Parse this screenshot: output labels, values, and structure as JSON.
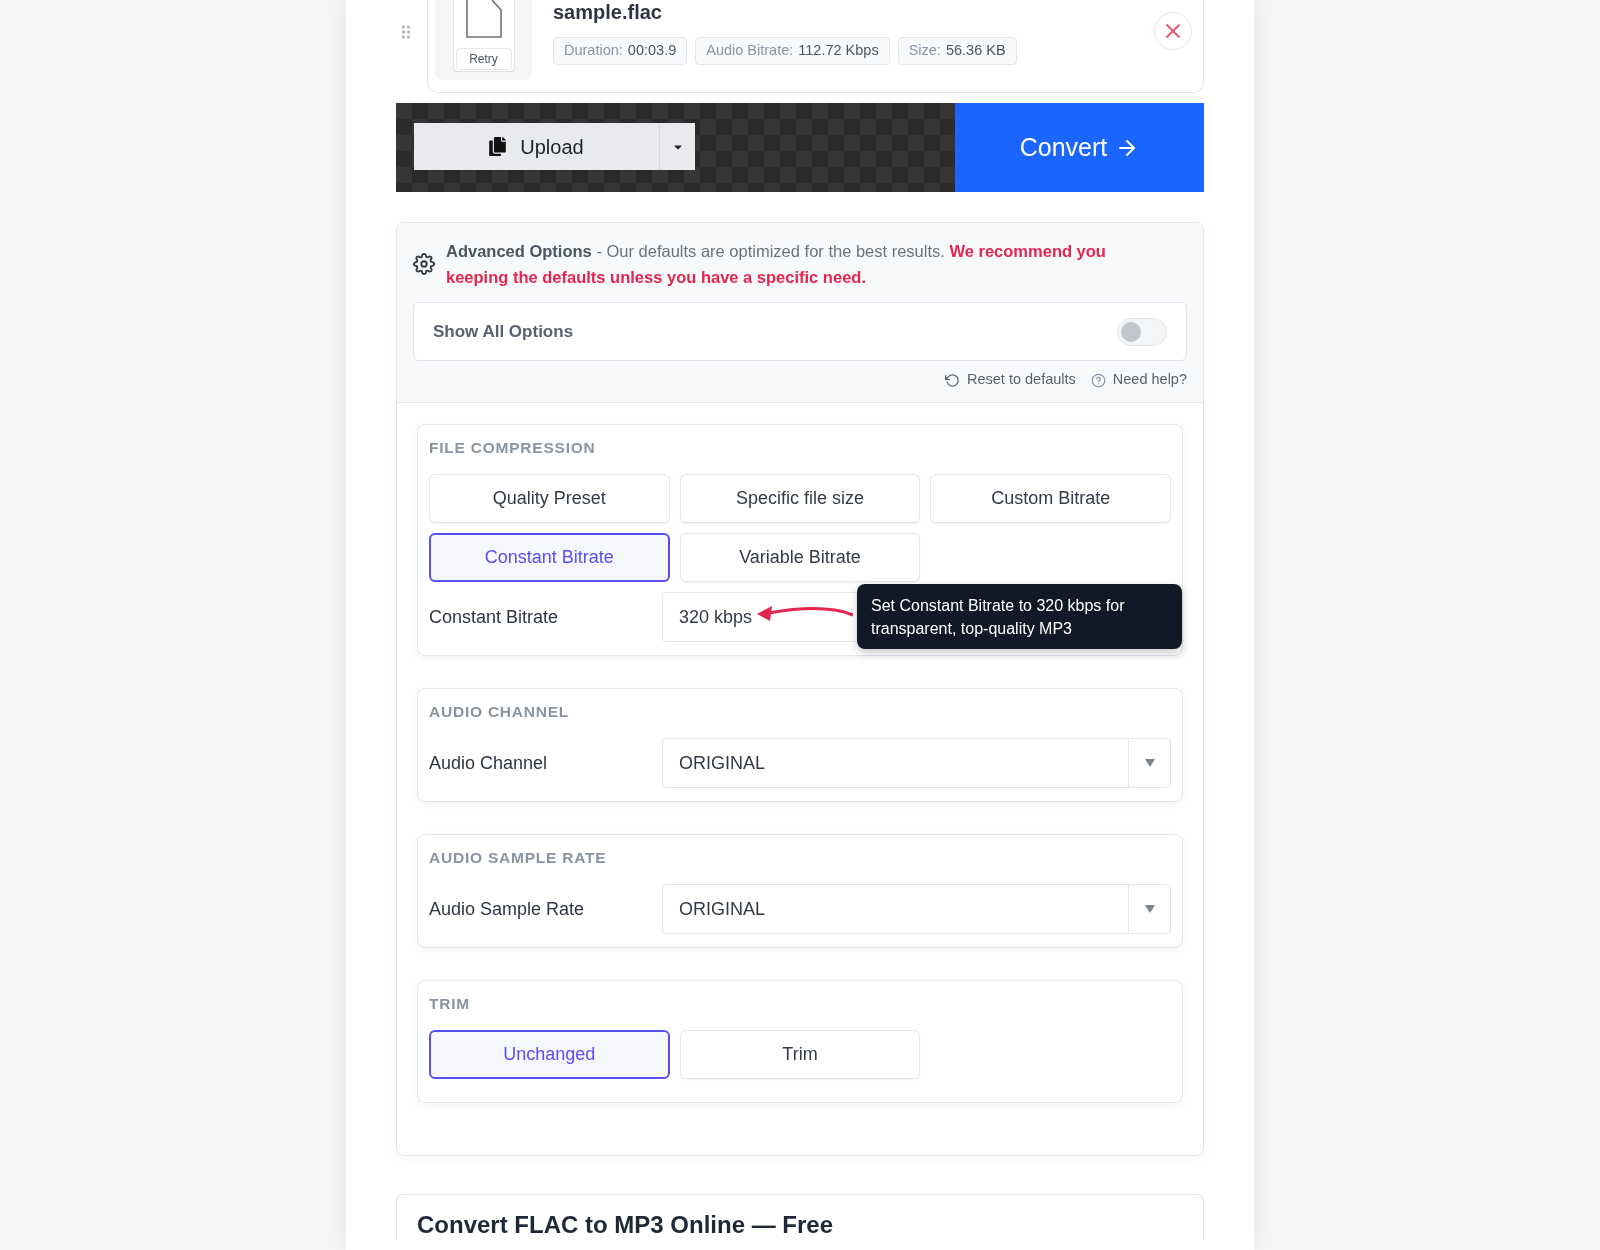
{
  "file": {
    "name": "sample.flac",
    "retry": "Retry",
    "details": [
      {
        "label": "Duration:",
        "value": "00:03.9"
      },
      {
        "label": "Audio Bitrate:",
        "value": "112.72 Kbps"
      },
      {
        "label": "Size:",
        "value": "56.36 KB"
      }
    ]
  },
  "toolbar": {
    "upload": "Upload",
    "convert": "Convert"
  },
  "advanced_options": {
    "title": "Advanced Options",
    "description": "- Our defaults are optimized for the best results.",
    "warning": "We recommend you keeping the defaults unless you have a specific need.",
    "show_all": {
      "label": "Show All Options",
      "on": false
    },
    "links": [
      {
        "kind": "reset",
        "label": "Reset to defaults"
      },
      {
        "kind": "help",
        "label": "Need help?"
      }
    ]
  },
  "sections": [
    {
      "title": "FILE COMPRESSION",
      "options": [
        {
          "label": "Quality Preset",
          "selected": false
        },
        {
          "label": "Specific file size",
          "selected": false
        },
        {
          "label": "Custom Bitrate",
          "selected": false
        },
        {
          "label": "Constant Bitrate",
          "selected": true
        },
        {
          "label": "Variable Bitrate",
          "selected": false
        }
      ],
      "field": {
        "kind": "input",
        "label": "Constant Bitrate",
        "value": "320 kbps",
        "callout": "Set Constant Bitrate to 320 kbps for transparent, top-quality MP3"
      }
    },
    {
      "title": "AUDIO CHANNEL",
      "field": {
        "kind": "select",
        "label": "Audio Channel",
        "value": "ORIGINAL"
      }
    },
    {
      "title": "AUDIO SAMPLE RATE",
      "field": {
        "kind": "select",
        "label": "Audio Sample Rate",
        "value": "ORIGINAL"
      }
    },
    {
      "title": "TRIM",
      "options": [
        {
          "label": "Unchanged",
          "selected": true
        },
        {
          "label": "Trim",
          "selected": false
        }
      ]
    }
  ],
  "article": {
    "title": "Convert FLAC to MP3 Online — Free"
  }
}
